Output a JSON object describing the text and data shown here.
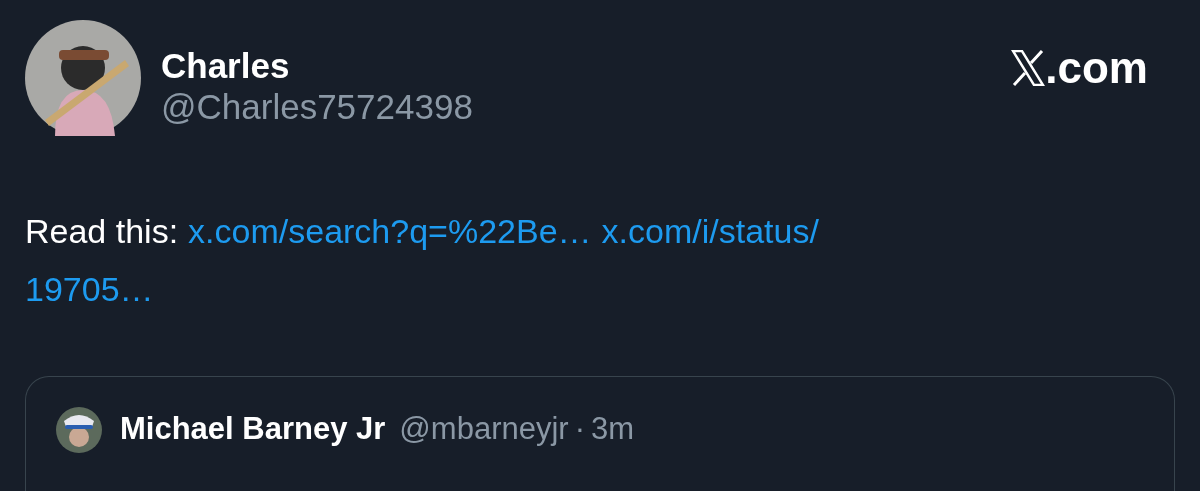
{
  "author": {
    "name": "Charles",
    "handle": "@Charles75724398"
  },
  "brand": {
    "text": ".com"
  },
  "body": {
    "lines": [
      [
        {
          "kind": "text",
          "text": "Read this:"
        },
        {
          "kind": "link",
          "text": "x.com/search?q=%22Be…"
        },
        {
          "kind": "link",
          "text": "x.com/i/status/"
        }
      ],
      [
        {
          "kind": "link",
          "text": "19705…"
        }
      ]
    ]
  },
  "quoted": {
    "name": "Michael Barney Jr",
    "handle": "@mbarneyjr",
    "separator": "·",
    "time": "3m"
  }
}
